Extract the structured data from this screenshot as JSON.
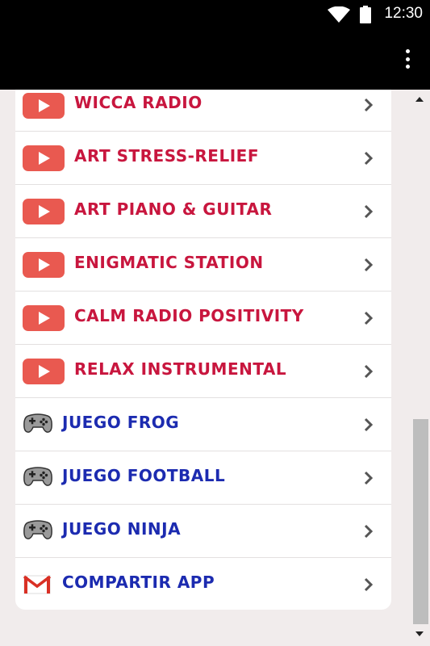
{
  "status_bar": {
    "time": "12:30",
    "icons": [
      "wifi-icon",
      "battery-icon"
    ]
  },
  "app_bar": {
    "menu_icon": "more-vertical-icon"
  },
  "colors": {
    "status_bar_bg": "#000000",
    "youtube_red": "#e95950",
    "radio_label": "#c8163e",
    "game_label": "#1c2bb0",
    "background": "#f1ecec"
  },
  "menu": {
    "items": [
      {
        "label": "WICCA RADIO",
        "icon": "youtube-play-icon"
      },
      {
        "label": "ART STRESS-RELIEF",
        "icon": "youtube-play-icon"
      },
      {
        "label": "ART PIANO & GUITAR",
        "icon": "youtube-play-icon"
      },
      {
        "label": "ENIGMATIC STATION",
        "icon": "youtube-play-icon"
      },
      {
        "label": "CALM RADIO POSITIVITY",
        "icon": "youtube-play-icon"
      },
      {
        "label": "RELAX INSTRUMENTAL",
        "icon": "youtube-play-icon"
      },
      {
        "label": "JUEGO FROG",
        "icon": "gamepad-icon"
      },
      {
        "label": "JUEGO FOOTBALL",
        "icon": "gamepad-icon"
      },
      {
        "label": "JUEGO NINJA",
        "icon": "gamepad-icon"
      },
      {
        "label": "COMPARTIR APP",
        "icon": "gmail-icon"
      }
    ]
  }
}
